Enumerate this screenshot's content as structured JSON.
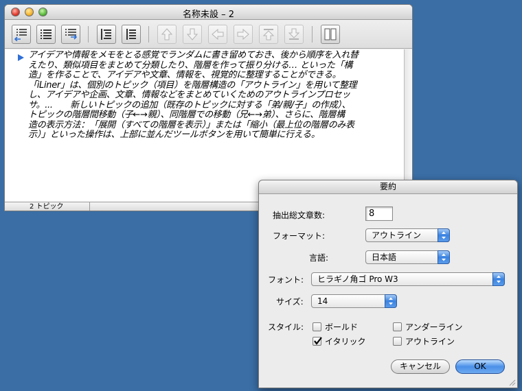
{
  "window": {
    "title": "名称未設 – 2",
    "status": "2 トピック"
  },
  "toolbar": {
    "buttons": [
      {
        "name": "add-topic-above-button",
        "icon": "add-above-icon",
        "enabled": true
      },
      {
        "name": "add-topic-button",
        "icon": "add-topic-icon",
        "enabled": true
      },
      {
        "name": "add-subtopic-button",
        "icon": "add-subtopic-icon",
        "enabled": true
      },
      {
        "name": "expand-all-button",
        "icon": "expand-icon",
        "enabled": true
      },
      {
        "name": "collapse-all-button",
        "icon": "collapse-icon",
        "enabled": true
      },
      {
        "name": "move-up-button",
        "icon": "arrow-up-icon",
        "enabled": false
      },
      {
        "name": "move-down-button",
        "icon": "arrow-down-icon",
        "enabled": false
      },
      {
        "name": "move-left-button",
        "icon": "arrow-left-icon",
        "enabled": false
      },
      {
        "name": "move-right-button",
        "icon": "arrow-right-icon",
        "enabled": false
      },
      {
        "name": "move-top-button",
        "icon": "arrow-top-icon",
        "enabled": false
      },
      {
        "name": "move-bottom-button",
        "icon": "arrow-bottom-icon",
        "enabled": false
      },
      {
        "name": "split-view-button",
        "icon": "split-view-icon",
        "enabled": true
      }
    ]
  },
  "outline": {
    "lines": [
      "アイデアや情報をメモをとる感覚でランダムに書き留めておき、後から順序を入れ替",
      "えたり、類似項目をまとめて分類したり、階層を作って振り分ける… といった「構",
      "造」を作ることで、アイデアや文章、情報を、視覚的に整理することができる。",
      "「iLiner」は、個別のトピック（項目）を階層構造の「アウトライン」を用いて整理",
      "し、アイデアや企画、文章、情報などをまとめていくためのアウトラインプロセッ",
      "サ。...　　新しいトピックの追加（既存のトピックに対する「弟/親/子」の作成）、",
      "トピックの階層間移動（子←→親）、同階層での移動（兄←→弟）、さらに、階層構",
      "造の表示方法：「展開（すべての階層を表示）」または「縮小（最上位の階層のみ表",
      "示）」といった操作は、上部に並んだツールボタンを用いて簡単に行える。"
    ]
  },
  "dialog": {
    "title": "要約",
    "sentences_label": "抽出総文章数:",
    "sentences_value": "8",
    "format_label": "フォーマット:",
    "format_value": "アウトライン",
    "language_label": "言語:",
    "language_value": "日本語",
    "font_label": "フォント:",
    "font_value": "ヒラギノ角ゴ Pro W3",
    "size_label": "サイズ:",
    "size_value": "14",
    "style_label": "スタイル:",
    "styles": {
      "bold": {
        "label": "ボールド",
        "checked": false
      },
      "italic": {
        "label": "イタリック",
        "checked": true
      },
      "underline": {
        "label": "アンダーライン",
        "checked": false
      },
      "outline": {
        "label": "アウトライン",
        "checked": false
      }
    },
    "cancel_label": "キャンセル",
    "ok_label": "OK"
  },
  "colors": {
    "desktop": "#3a6ea5",
    "aqua_blue": "#3b83e0",
    "disclosure": "#2f6fd6"
  }
}
